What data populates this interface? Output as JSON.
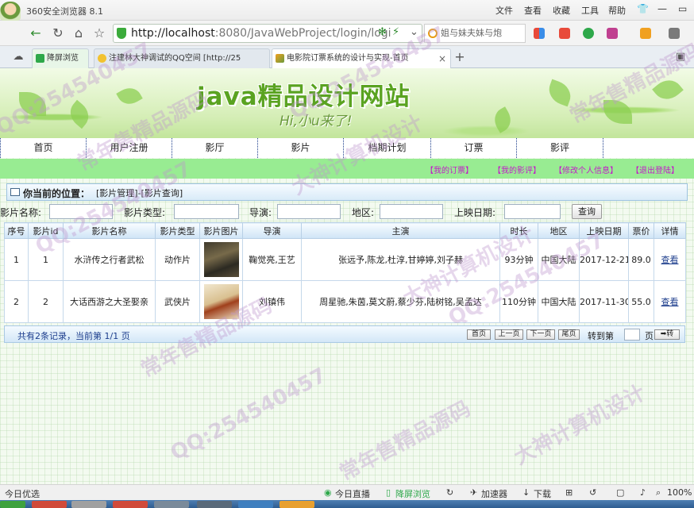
{
  "browser": {
    "name": "360安全浏览器 8.1",
    "menu": [
      "文件",
      "查看",
      "收藏",
      "工具",
      "帮助"
    ],
    "url_host": "http://localhost",
    "url_rest": ":8080/JavaWebProject/login/logi",
    "search_text": "姐与妹夫妹与炮",
    "tabs": [
      {
        "label": "降屏浏览"
      },
      {
        "label": "注建林大神调试的QQ空间 [http://25"
      },
      {
        "label": "电影院订票系统的设计与实现-首页"
      }
    ]
  },
  "site": {
    "title": "java精品设计网站",
    "slogan": "Hi,小u来了!"
  },
  "nav": [
    "首页",
    "用户注册",
    "影厅",
    "影片",
    "档期计划",
    "订票",
    "影评"
  ],
  "user_links": [
    "【我的订票】",
    "【我的影评】",
    "【修改个人信息】",
    "【退出登陆】"
  ],
  "location": {
    "label": "你当前的位置：",
    "value": "[影片管理]-[影片查询]"
  },
  "filter": {
    "name_label": "影片名称:",
    "type_label": "影片类型:",
    "director_label": "导演:",
    "region_label": "地区:",
    "date_label": "上映日期:",
    "search_button": "查询"
  },
  "table": {
    "headers": [
      "序号",
      "影片id",
      "影片名称",
      "影片类型",
      "影片图片",
      "导演",
      "主演",
      "时长",
      "地区",
      "上映日期",
      "票价",
      "详情"
    ],
    "rows": [
      {
        "no": "1",
        "id": "1",
        "name": "水浒传之行者武松",
        "type": "动作片",
        "director": "鞠觉亮,王艺",
        "actors": "张远予,陈龙,杜淳,甘婷婷,刘子赫",
        "duration": "93分钟",
        "region": "中国大陆",
        "date": "2017-12-21",
        "price": "89.0",
        "detail": "查看"
      },
      {
        "no": "2",
        "id": "2",
        "name": "大话西游之大圣娶亲",
        "type": "武侠片",
        "director": "刘镇伟",
        "actors": "周星驰,朱茵,莫文蔚,蔡少芬,陆树铭,吴孟达",
        "duration": "110分钟",
        "region": "中国大陆",
        "date": "2017-11-30",
        "price": "55.0",
        "detail": "查看"
      }
    ]
  },
  "pager": {
    "info": "共有2条记录，当前第 1/1 页",
    "buttons": [
      "首页",
      "上一页",
      "下一页",
      "尾页"
    ],
    "goto_label": "转到第",
    "page_unit": "页",
    "go_button": "➡转"
  },
  "status": {
    "left": "今日优选",
    "items": [
      "今日直播",
      "降屏浏览",
      "加速器",
      "下载"
    ],
    "zoom": "100%"
  },
  "watermark": [
    "QQ:254540457",
    "常年售精品源码",
    "大神计算机设计"
  ]
}
